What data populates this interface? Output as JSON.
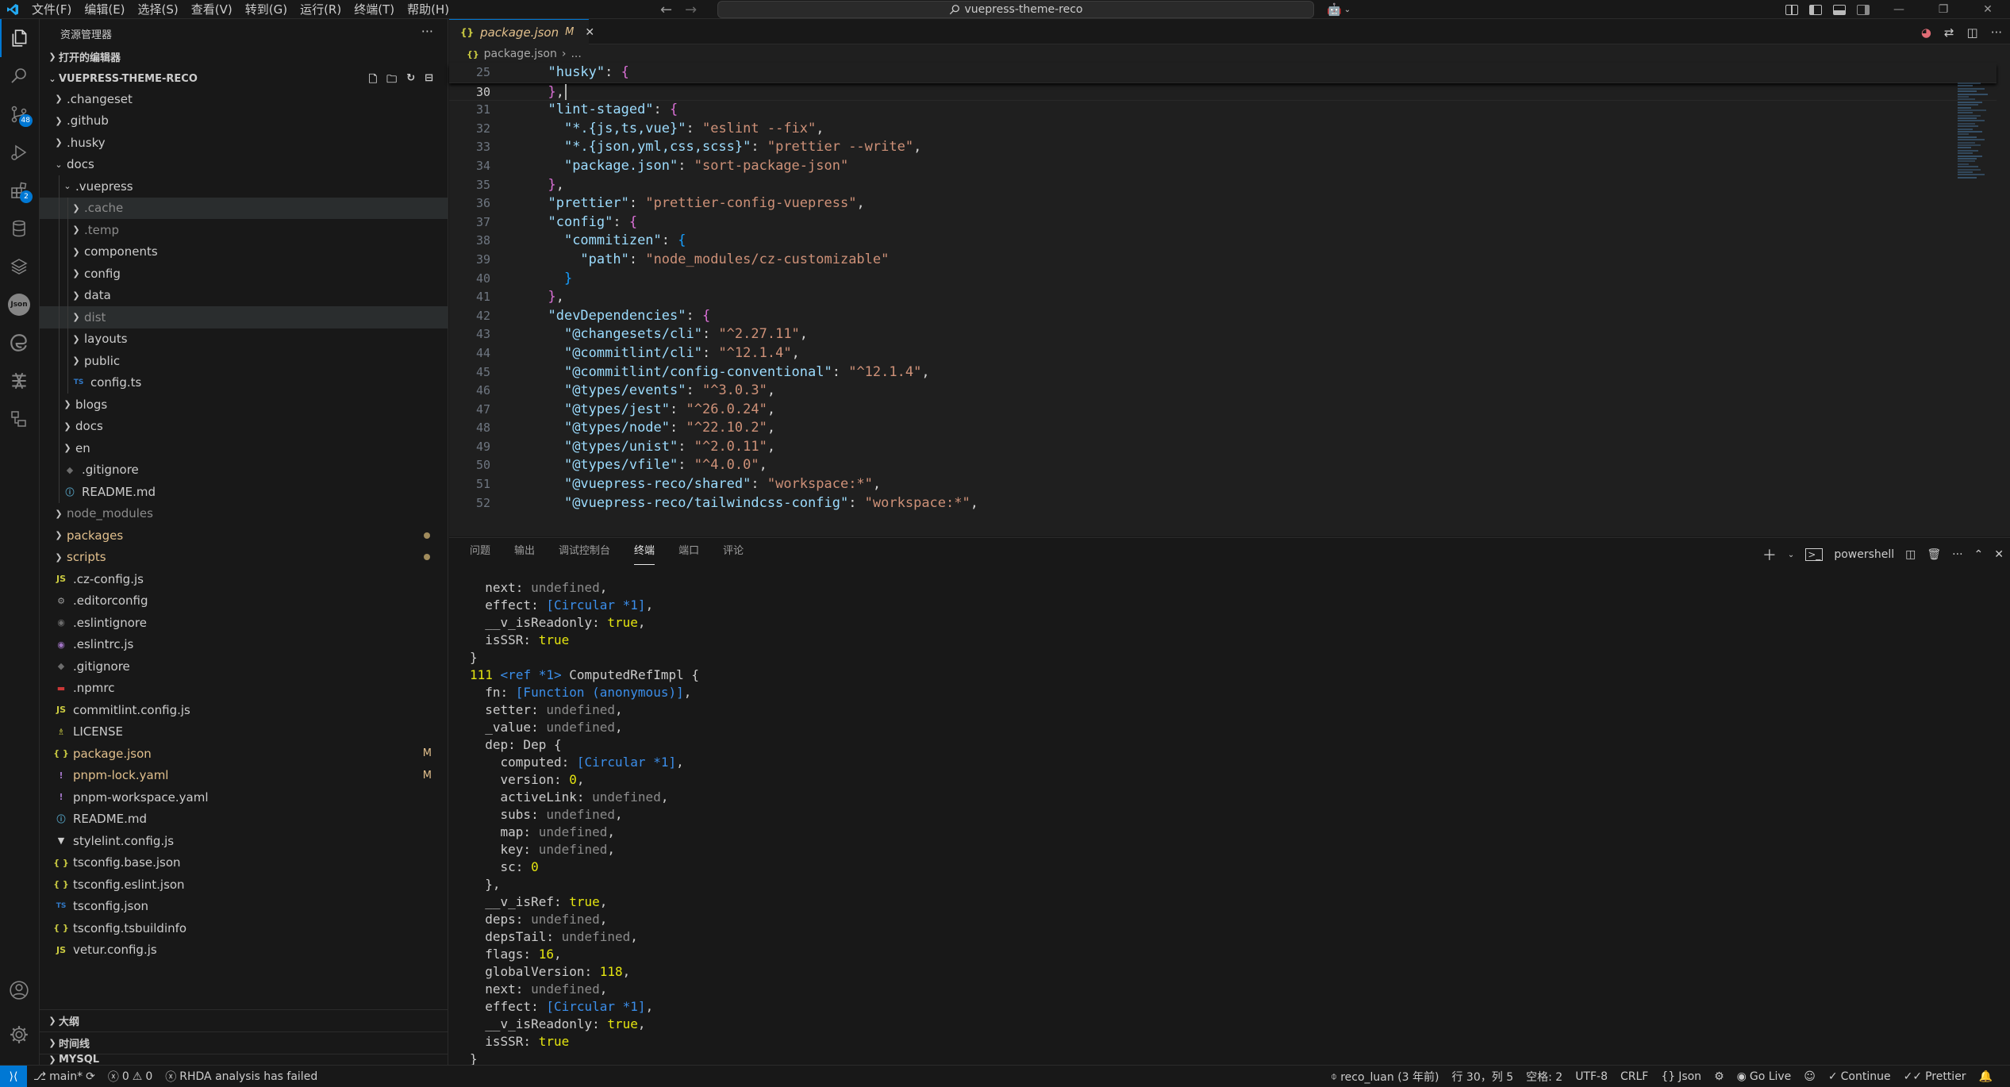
{
  "window": {
    "menu": [
      "文件(F)",
      "编辑(E)",
      "选择(S)",
      "查看(V)",
      "转到(G)",
      "运行(R)",
      "终端(T)",
      "帮助(H)"
    ],
    "search_text": "vuepress-theme-reco"
  },
  "activity": {
    "scm_badge": "48",
    "extensions_badge": "2"
  },
  "sidebar": {
    "title": "资源管理器",
    "open_editors": "打开的编辑器",
    "root": "VUEPRESS-THEME-RECO",
    "tree": [
      {
        "label": ".changeset",
        "type": "folder",
        "depth": 0
      },
      {
        "label": ".github",
        "type": "folder",
        "depth": 0
      },
      {
        "label": ".husky",
        "type": "folder",
        "depth": 0
      },
      {
        "label": "docs",
        "type": "folder-open",
        "depth": 0
      },
      {
        "label": ".vuepress",
        "type": "folder-open",
        "depth": 1
      },
      {
        "label": ".cache",
        "type": "folder",
        "depth": 2,
        "dim": true,
        "sel": true
      },
      {
        "label": ".temp",
        "type": "folder",
        "depth": 2,
        "dim": true
      },
      {
        "label": "components",
        "type": "folder",
        "depth": 2
      },
      {
        "label": "config",
        "type": "folder",
        "depth": 2
      },
      {
        "label": "data",
        "type": "folder",
        "depth": 2
      },
      {
        "label": "dist",
        "type": "folder",
        "depth": 2,
        "dim": true,
        "sel": true
      },
      {
        "label": "layouts",
        "type": "folder",
        "depth": 2
      },
      {
        "label": "public",
        "type": "folder",
        "depth": 2
      },
      {
        "label": "config.ts",
        "type": "ts",
        "depth": 2
      },
      {
        "label": "blogs",
        "type": "folder",
        "depth": 1
      },
      {
        "label": "docs",
        "type": "folder",
        "depth": 1
      },
      {
        "label": "en",
        "type": "folder",
        "depth": 1
      },
      {
        "label": ".gitignore",
        "type": "git",
        "depth": 1
      },
      {
        "label": "README.md",
        "type": "info",
        "depth": 1
      },
      {
        "label": "node_modules",
        "type": "folder",
        "depth": 0,
        "dim": true
      },
      {
        "label": "packages",
        "type": "folder",
        "depth": 0,
        "mod": true,
        "dot": true
      },
      {
        "label": "scripts",
        "type": "folder",
        "depth": 0,
        "mod": true,
        "dot": true
      },
      {
        "label": ".cz-config.js",
        "type": "js",
        "depth": 0
      },
      {
        "label": ".editorconfig",
        "type": "gear",
        "depth": 0
      },
      {
        "label": ".eslintignore",
        "type": "eslint",
        "depth": 0
      },
      {
        "label": ".eslintrc.js",
        "type": "eslintp",
        "depth": 0
      },
      {
        "label": ".gitignore",
        "type": "git",
        "depth": 0
      },
      {
        "label": ".npmrc",
        "type": "npm",
        "depth": 0
      },
      {
        "label": "commitlint.config.js",
        "type": "js",
        "depth": 0
      },
      {
        "label": "LICENSE",
        "type": "license",
        "depth": 0
      },
      {
        "label": "package.json",
        "type": "json",
        "depth": 0,
        "mod": true,
        "status": "M"
      },
      {
        "label": "pnpm-lock.yaml",
        "type": "yaml",
        "depth": 0,
        "mod": true,
        "status": "M"
      },
      {
        "label": "pnpm-workspace.yaml",
        "type": "yaml",
        "depth": 0
      },
      {
        "label": "README.md",
        "type": "info",
        "depth": 0
      },
      {
        "label": "stylelint.config.js",
        "type": "style",
        "depth": 0
      },
      {
        "label": "tsconfig.base.json",
        "type": "json",
        "depth": 0
      },
      {
        "label": "tsconfig.eslint.json",
        "type": "json",
        "depth": 0
      },
      {
        "label": "tsconfig.json",
        "type": "tsjson",
        "depth": 0
      },
      {
        "label": "tsconfig.tsbuildinfo",
        "type": "json",
        "depth": 0
      },
      {
        "label": "vetur.config.js",
        "type": "js",
        "depth": 0
      }
    ],
    "outline": "大纲",
    "timeline": "时间线",
    "mysql": "MYSQL"
  },
  "editor": {
    "tab_name": "package.json",
    "tab_status": "M",
    "breadcrumb_file": "package.json",
    "breadcrumb_more": "...",
    "lines": [
      {
        "n": "25",
        "sticky": true,
        "parts": [
          [
            "p",
            "  "
          ],
          [
            "k",
            "\"husky\""
          ],
          [
            "p",
            ": "
          ],
          [
            "b2",
            "{"
          ]
        ]
      },
      {
        "n": "30",
        "cur": true,
        "parts": [
          [
            "p",
            "  "
          ],
          [
            "b2",
            "}"
          ],
          [
            "p",
            ","
          ]
        ]
      },
      {
        "n": "31",
        "parts": [
          [
            "p",
            "  "
          ],
          [
            "k",
            "\"lint-staged\""
          ],
          [
            "p",
            ": "
          ],
          [
            "b2",
            "{"
          ]
        ]
      },
      {
        "n": "32",
        "parts": [
          [
            "p",
            "    "
          ],
          [
            "k",
            "\"*.{js,ts,vue}\""
          ],
          [
            "p",
            ": "
          ],
          [
            "s",
            "\"eslint --fix\""
          ],
          [
            "p",
            ","
          ]
        ]
      },
      {
        "n": "33",
        "parts": [
          [
            "p",
            "    "
          ],
          [
            "k",
            "\"*.{json,yml,css,scss}\""
          ],
          [
            "p",
            ": "
          ],
          [
            "s",
            "\"prettier --write\""
          ],
          [
            "p",
            ","
          ]
        ]
      },
      {
        "n": "34",
        "parts": [
          [
            "p",
            "    "
          ],
          [
            "k",
            "\"package.json\""
          ],
          [
            "p",
            ": "
          ],
          [
            "s",
            "\"sort-package-json\""
          ]
        ]
      },
      {
        "n": "35",
        "parts": [
          [
            "p",
            "  "
          ],
          [
            "b2",
            "}"
          ],
          [
            "p",
            ","
          ]
        ]
      },
      {
        "n": "36",
        "parts": [
          [
            "p",
            "  "
          ],
          [
            "k",
            "\"prettier\""
          ],
          [
            "p",
            ": "
          ],
          [
            "s",
            "\"prettier-config-vuepress\""
          ],
          [
            "p",
            ","
          ]
        ]
      },
      {
        "n": "37",
        "parts": [
          [
            "p",
            "  "
          ],
          [
            "k",
            "\"config\""
          ],
          [
            "p",
            ": "
          ],
          [
            "b2",
            "{"
          ]
        ]
      },
      {
        "n": "38",
        "parts": [
          [
            "p",
            "    "
          ],
          [
            "k",
            "\"commitizen\""
          ],
          [
            "p",
            ": "
          ],
          [
            "b3",
            "{"
          ]
        ]
      },
      {
        "n": "39",
        "parts": [
          [
            "p",
            "      "
          ],
          [
            "k",
            "\"path\""
          ],
          [
            "p",
            ": "
          ],
          [
            "s",
            "\"node_modules/cz-customizable\""
          ]
        ]
      },
      {
        "n": "40",
        "parts": [
          [
            "p",
            "    "
          ],
          [
            "b3",
            "}"
          ]
        ]
      },
      {
        "n": "41",
        "parts": [
          [
            "p",
            "  "
          ],
          [
            "b2",
            "}"
          ],
          [
            "p",
            ","
          ]
        ]
      },
      {
        "n": "42",
        "parts": [
          [
            "p",
            "  "
          ],
          [
            "k",
            "\"devDependencies\""
          ],
          [
            "p",
            ": "
          ],
          [
            "b2",
            "{"
          ]
        ]
      },
      {
        "n": "43",
        "parts": [
          [
            "p",
            "    "
          ],
          [
            "k",
            "\"@changesets/cli\""
          ],
          [
            "p",
            ": "
          ],
          [
            "s",
            "\"^2.27.11\""
          ],
          [
            "p",
            ","
          ]
        ]
      },
      {
        "n": "44",
        "parts": [
          [
            "p",
            "    "
          ],
          [
            "k",
            "\"@commitlint/cli\""
          ],
          [
            "p",
            ": "
          ],
          [
            "s",
            "\"^12.1.4\""
          ],
          [
            "p",
            ","
          ]
        ]
      },
      {
        "n": "45",
        "parts": [
          [
            "p",
            "    "
          ],
          [
            "k",
            "\"@commitlint/config-conventional\""
          ],
          [
            "p",
            ": "
          ],
          [
            "s",
            "\"^12.1.4\""
          ],
          [
            "p",
            ","
          ]
        ]
      },
      {
        "n": "46",
        "parts": [
          [
            "p",
            "    "
          ],
          [
            "k",
            "\"@types/events\""
          ],
          [
            "p",
            ": "
          ],
          [
            "s",
            "\"^3.0.3\""
          ],
          [
            "p",
            ","
          ]
        ]
      },
      {
        "n": "47",
        "parts": [
          [
            "p",
            "    "
          ],
          [
            "k",
            "\"@types/jest\""
          ],
          [
            "p",
            ": "
          ],
          [
            "s",
            "\"^26.0.24\""
          ],
          [
            "p",
            ","
          ]
        ]
      },
      {
        "n": "48",
        "parts": [
          [
            "p",
            "    "
          ],
          [
            "k",
            "\"@types/node\""
          ],
          [
            "p",
            ": "
          ],
          [
            "s",
            "\"^22.10.2\""
          ],
          [
            "p",
            ","
          ]
        ]
      },
      {
        "n": "49",
        "parts": [
          [
            "p",
            "    "
          ],
          [
            "k",
            "\"@types/unist\""
          ],
          [
            "p",
            ": "
          ],
          [
            "s",
            "\"^2.0.11\""
          ],
          [
            "p",
            ","
          ]
        ]
      },
      {
        "n": "50",
        "parts": [
          [
            "p",
            "    "
          ],
          [
            "k",
            "\"@types/vfile\""
          ],
          [
            "p",
            ": "
          ],
          [
            "s",
            "\"^4.0.0\""
          ],
          [
            "p",
            ","
          ]
        ]
      },
      {
        "n": "51",
        "parts": [
          [
            "p",
            "    "
          ],
          [
            "k",
            "\"@vuepress-reco/shared\""
          ],
          [
            "p",
            ": "
          ],
          [
            "s",
            "\"workspace:*\""
          ],
          [
            "p",
            ","
          ]
        ]
      },
      {
        "n": "52",
        "parts": [
          [
            "p",
            "    "
          ],
          [
            "k",
            "\"@vuepress-reco/tailwindcss-config\""
          ],
          [
            "p",
            ": "
          ],
          [
            "s",
            "\"workspace:*\""
          ],
          [
            "p",
            ","
          ]
        ]
      }
    ]
  },
  "panel": {
    "tabs": [
      "问题",
      "输出",
      "调试控制台",
      "终端",
      "端口",
      "评论"
    ],
    "active_tab": "终端",
    "shell": "powershell",
    "terminal": [
      [
        [
          "w",
          "  next: "
        ],
        [
          "g",
          "undefined"
        ],
        [
          "w",
          ","
        ]
      ],
      [
        [
          "w",
          "  effect: "
        ],
        [
          "c",
          "[Circular *1]"
        ],
        [
          "w",
          ","
        ]
      ],
      [
        [
          "w",
          "  __v_isReadonly: "
        ],
        [
          "y",
          "true"
        ],
        [
          "w",
          ","
        ]
      ],
      [
        [
          "w",
          "  isSSR: "
        ],
        [
          "y",
          "true"
        ]
      ],
      [
        [
          "w",
          "}"
        ]
      ],
      [
        [
          "y",
          "111"
        ],
        [
          "w",
          " "
        ],
        [
          "c",
          "<ref *1>"
        ],
        [
          "w",
          " ComputedRefImpl {"
        ]
      ],
      [
        [
          "w",
          "  fn: "
        ],
        [
          "c",
          "[Function (anonymous)]"
        ],
        [
          "w",
          ","
        ]
      ],
      [
        [
          "w",
          "  setter: "
        ],
        [
          "g",
          "undefined"
        ],
        [
          "w",
          ","
        ]
      ],
      [
        [
          "w",
          "  _value: "
        ],
        [
          "g",
          "undefined"
        ],
        [
          "w",
          ","
        ]
      ],
      [
        [
          "w",
          "  dep: Dep {"
        ]
      ],
      [
        [
          "w",
          "    computed: "
        ],
        [
          "c",
          "[Circular *1]"
        ],
        [
          "w",
          ","
        ]
      ],
      [
        [
          "w",
          "    version: "
        ],
        [
          "y",
          "0"
        ],
        [
          "w",
          ","
        ]
      ],
      [
        [
          "w",
          "    activeLink: "
        ],
        [
          "g",
          "undefined"
        ],
        [
          "w",
          ","
        ]
      ],
      [
        [
          "w",
          "    subs: "
        ],
        [
          "g",
          "undefined"
        ],
        [
          "w",
          ","
        ]
      ],
      [
        [
          "w",
          "    map: "
        ],
        [
          "g",
          "undefined"
        ],
        [
          "w",
          ","
        ]
      ],
      [
        [
          "w",
          "    key: "
        ],
        [
          "g",
          "undefined"
        ],
        [
          "w",
          ","
        ]
      ],
      [
        [
          "w",
          "    sc: "
        ],
        [
          "y",
          "0"
        ]
      ],
      [
        [
          "w",
          "  },"
        ]
      ],
      [
        [
          "w",
          "  __v_isRef: "
        ],
        [
          "y",
          "true"
        ],
        [
          "w",
          ","
        ]
      ],
      [
        [
          "w",
          "  deps: "
        ],
        [
          "g",
          "undefined"
        ],
        [
          "w",
          ","
        ]
      ],
      [
        [
          "w",
          "  depsTail: "
        ],
        [
          "g",
          "undefined"
        ],
        [
          "w",
          ","
        ]
      ],
      [
        [
          "w",
          "  flags: "
        ],
        [
          "y",
          "16"
        ],
        [
          "w",
          ","
        ]
      ],
      [
        [
          "w",
          "  globalVersion: "
        ],
        [
          "y",
          "118"
        ],
        [
          "w",
          ","
        ]
      ],
      [
        [
          "w",
          "  next: "
        ],
        [
          "g",
          "undefined"
        ],
        [
          "w",
          ","
        ]
      ],
      [
        [
          "w",
          "  effect: "
        ],
        [
          "c",
          "[Circular *1]"
        ],
        [
          "w",
          ","
        ]
      ],
      [
        [
          "w",
          "  __v_isReadonly: "
        ],
        [
          "y",
          "true"
        ],
        [
          "w",
          ","
        ]
      ],
      [
        [
          "w",
          "  isSSR: "
        ],
        [
          "y",
          "true"
        ]
      ],
      [
        [
          "w",
          "}"
        ]
      ]
    ]
  },
  "status": {
    "branch": "main*",
    "errors": "0",
    "warnings": "0",
    "rhda": "RHDA analysis has failed",
    "blame": "reco_luan (3 年前)",
    "position": "行 30，列 5",
    "spaces": "空格: 2",
    "encoding": "UTF-8",
    "eol": "CRLF",
    "language": "Json",
    "golive": "Go Live",
    "continue": "Continue",
    "prettier": "Prettier"
  },
  "colors": {
    "accent": "#0078d4",
    "modified": "#e2c08d",
    "string": "#ce9178",
    "key": "#9cdcfe"
  }
}
